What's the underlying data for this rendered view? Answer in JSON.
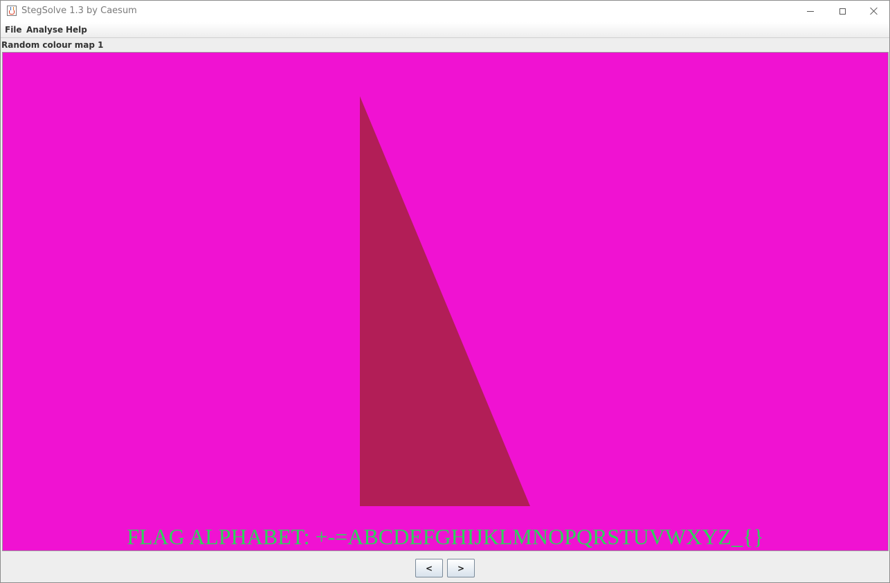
{
  "window": {
    "title": "StegSolve 1.3 by Caesum",
    "controls": [
      "minimize-icon",
      "maximize-icon",
      "close-icon"
    ]
  },
  "menu": {
    "file": "File",
    "analyse": "Analyse",
    "help": "Help"
  },
  "panel": {
    "label": "Random colour map 1",
    "background_color": "#f012d2",
    "triangle_color": "#b21e57",
    "flag_text": "FLAG ALPHABET: +-=ABCDEFGHIJKLMNOPQRSTUVWXYZ_{}",
    "flag_text_color": "#2fd25c"
  },
  "navigation": {
    "prev_label": "<",
    "next_label": ">"
  }
}
